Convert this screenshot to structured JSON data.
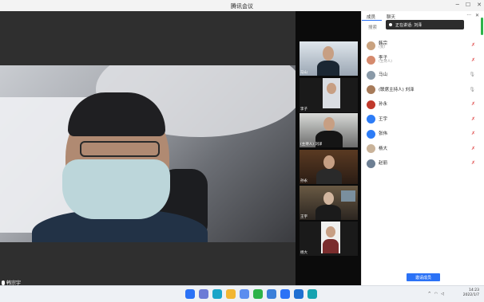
{
  "window": {
    "title": "腾讯会议"
  },
  "main_video": {
    "name": "韩宗宇"
  },
  "thumbnails": [
    {
      "label": "马山"
    },
    {
      "label": "李子"
    },
    {
      "label": "(主持人) 刘泽"
    },
    {
      "label": "孙永"
    },
    {
      "label": "王宇"
    },
    {
      "label": "杨大"
    }
  ],
  "panel": {
    "tabs": [
      "成员",
      "聊天"
    ],
    "more": "···",
    "close": "✕",
    "toast": "正在讲话: 刘泽",
    "search_label": "搜索",
    "invite_label": "邀请成员"
  },
  "participants": [
    {
      "name": "韩宗",
      "sub": "(我)",
      "mic": "off"
    },
    {
      "name": "李子",
      "sub": "(主持人)",
      "mic": "off"
    },
    {
      "name": "马山",
      "sub": "",
      "mic": "on"
    },
    {
      "name": "(联席主持人) 刘泽",
      "sub": "",
      "mic": "on"
    },
    {
      "name": "孙永",
      "sub": "",
      "mic": "off"
    },
    {
      "name": "王宇",
      "sub": "",
      "mic": "off"
    },
    {
      "name": "张伟",
      "sub": "",
      "mic": "off"
    },
    {
      "name": "杨大",
      "sub": "",
      "mic": "off"
    },
    {
      "name": "赵丽",
      "sub": "",
      "mic": "off"
    }
  ],
  "tray": {
    "time": "14:23",
    "date": "2022/1/7"
  },
  "taskbar_icons": [
    {
      "name": "windows-start",
      "color": "#2b72f6"
    },
    {
      "name": "search",
      "color": "#6b7bd6"
    },
    {
      "name": "edge",
      "color": "#1aa5c9"
    },
    {
      "name": "file-explorer",
      "color": "#f2b632"
    },
    {
      "name": "notes",
      "color": "#5b8def"
    },
    {
      "name": "wechat",
      "color": "#2db34a"
    },
    {
      "name": "photos",
      "color": "#3b7fd9"
    },
    {
      "name": "meeting",
      "color": "#2b72f6"
    },
    {
      "name": "mail",
      "color": "#1f6fd1"
    },
    {
      "name": "media",
      "color": "#16a3b0"
    }
  ]
}
